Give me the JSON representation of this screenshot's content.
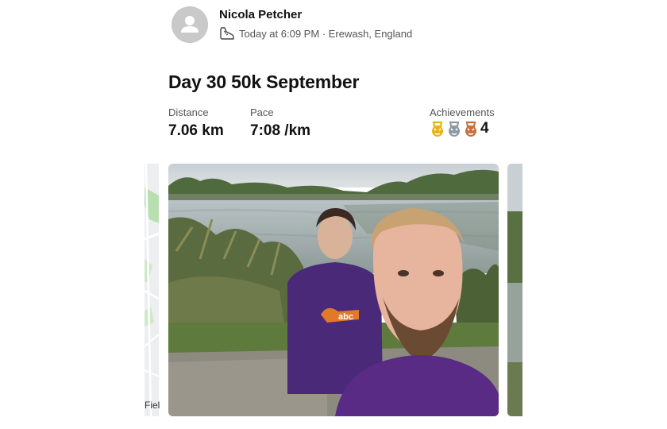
{
  "athlete": {
    "name": "Nicola Petcher"
  },
  "activity": {
    "meta": "Today at 6:09 PM · Erewash, England",
    "icon": "running-shoe-icon",
    "title": "Day 30 50k September"
  },
  "stats": {
    "distance": {
      "label": "Distance",
      "value": "7.06 km"
    },
    "pace": {
      "label": "Pace",
      "value": "7:08 /km"
    },
    "achievements": {
      "label": "Achievements",
      "count": "4",
      "medals": [
        {
          "name": "gold-kettlebell-icon",
          "color": "#e8b516"
        },
        {
          "name": "silver-kettlebell-icon",
          "color": "#8c9aa3"
        },
        {
          "name": "bronze-kettlebell-icon",
          "color": "#c8703e"
        }
      ]
    }
  },
  "media": {
    "map_label": "Fiel"
  }
}
